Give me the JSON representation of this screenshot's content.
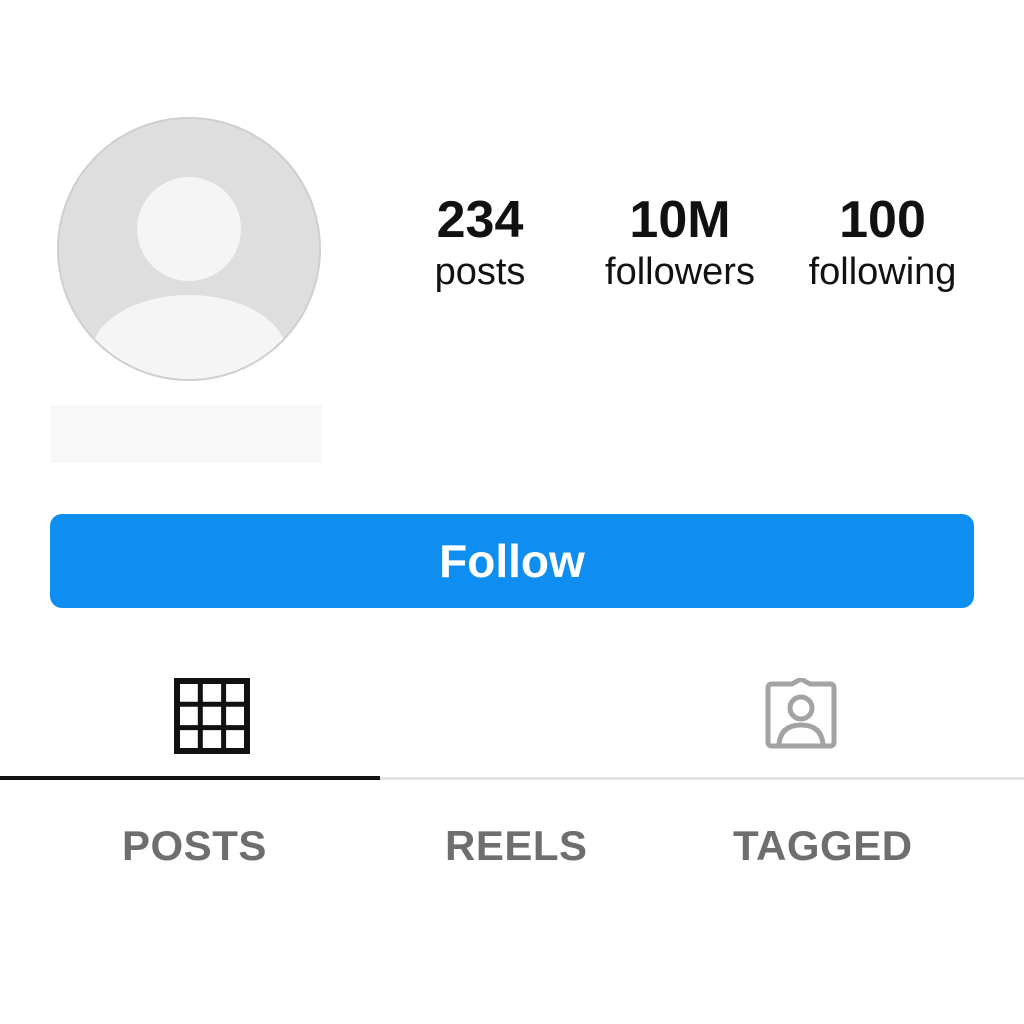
{
  "profile": {
    "stats": [
      {
        "value": "234",
        "label": "posts"
      },
      {
        "value": "10M",
        "label": "followers"
      },
      {
        "value": "100",
        "label": "following"
      }
    ]
  },
  "actions": {
    "follow_label": "Follow"
  },
  "tabs": [
    {
      "label": "POSTS",
      "icon": "grid-icon",
      "active": true
    },
    {
      "label": "REELS"
    },
    {
      "label": "TAGGED",
      "icon": "tagged-person-icon"
    }
  ],
  "colors": {
    "follow_button": "#0e8ef0",
    "active_tab_indicator": "#111111",
    "tab_label": "#6e6e6e"
  }
}
